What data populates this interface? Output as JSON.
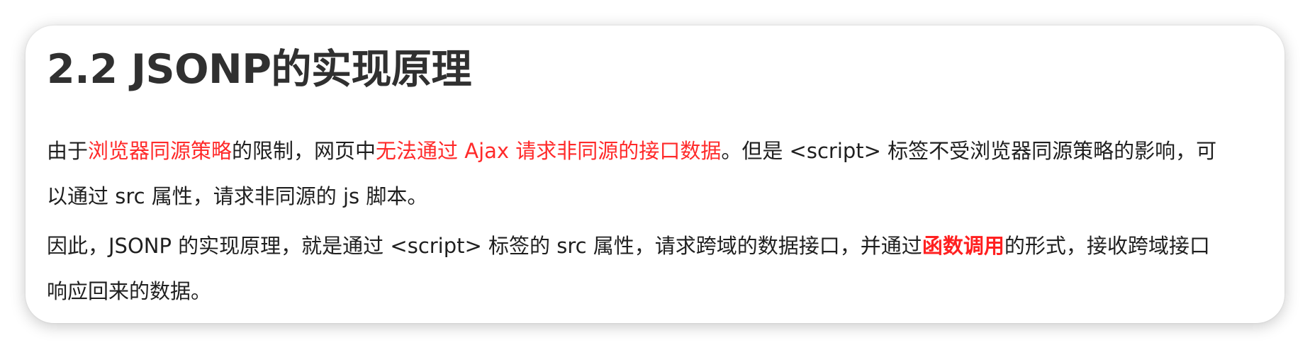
{
  "title": "2.2 JSONP的实现原理",
  "paragraph1": {
    "t1": "由于",
    "h1": "浏览器同源策略",
    "t2": "的限制，网页中",
    "h2": "无法通过 Ajax 请求非同源的接口数据",
    "t3": "。但是 <script> 标签不受浏览器同源策略的影响，可以通过 src 属性，请求非同源的 js 脚本。"
  },
  "paragraph2": {
    "t1": "因此，JSONP 的实现原理，就是通过 <script> 标签的 src 属性，请求跨域的数据接口，并通过",
    "h1": "函数调用",
    "t2": "的形式，接收跨域接口响应回来的数据。"
  },
  "colors": {
    "highlight": "#ff2a2a",
    "text": "#1f1f1f",
    "title": "#303030"
  }
}
